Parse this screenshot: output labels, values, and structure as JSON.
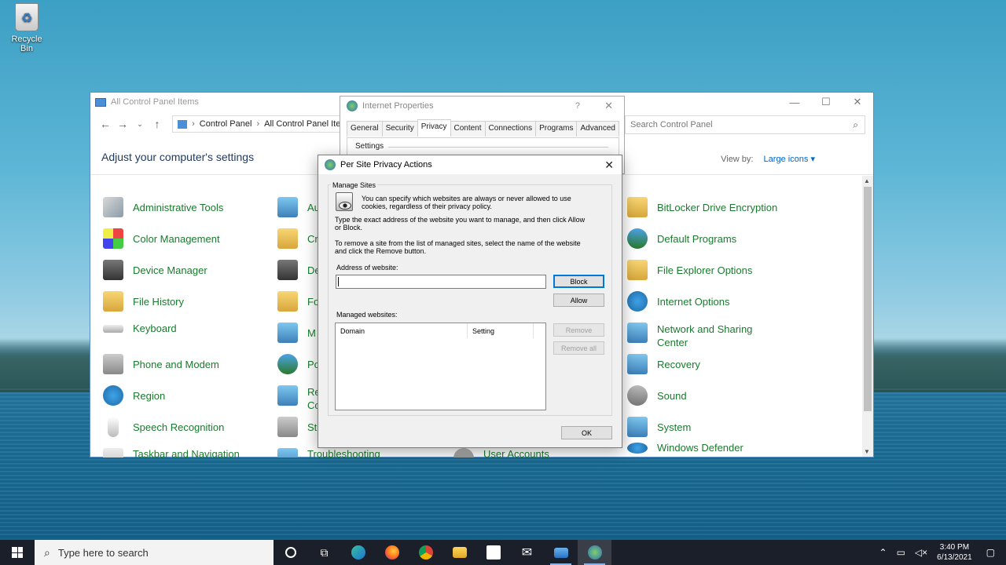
{
  "desktop": {
    "recycle_bin": "Recycle Bin"
  },
  "control_panel": {
    "title": "All Control Panel Items",
    "breadcrumb": [
      "Control Panel",
      "All Control Panel Items"
    ],
    "search_placeholder": "Search Control Panel",
    "heading": "Adjust your computer's settings",
    "view_by_label": "View by:",
    "view_by_value": "Large icons",
    "col1": [
      "Administrative Tools",
      "Color Management",
      "Device Manager",
      "File History",
      "Keyboard",
      "Phone and Modem",
      "Region",
      "Speech Recognition",
      "Taskbar and Navigation"
    ],
    "col2": [
      "Au",
      "Cr",
      "De",
      "Fo",
      "M",
      "Po",
      "Re",
      "Co",
      "St",
      "Troubleshooting"
    ],
    "col3": [
      "User Accounts"
    ],
    "col4": [
      "BitLocker Drive Encryption",
      "Default Programs",
      "File Explorer Options",
      "Internet Options",
      "Network and Sharing",
      "Center",
      "Recovery",
      "Sound",
      "System",
      "Windows Defender"
    ]
  },
  "internet_properties": {
    "title": "Internet Properties",
    "help": "?",
    "tabs": [
      "General",
      "Security",
      "Privacy",
      "Content",
      "Connections",
      "Programs",
      "Advanced"
    ],
    "active_tab": "Privacy",
    "settings_label": "Settings"
  },
  "per_site": {
    "title": "Per Site Privacy Actions",
    "group_label": "Manage Sites",
    "intro_line1": "You can specify which websites are always or never allowed to use",
    "intro_line2": "cookies, regardless of their privacy policy.",
    "type_line1": "Type the exact address of the website you want to manage, and then click Allow",
    "type_line2": "or Block.",
    "remove_line1": "To remove a site from the list of managed sites, select the name of the website",
    "remove_line2": "and click the Remove button.",
    "address_label": "Address of website:",
    "address_value": "",
    "block_label": "Block",
    "allow_label": "Allow",
    "managed_label": "Managed websites:",
    "col_domain": "Domain",
    "col_setting": "Setting",
    "remove_label": "Remove",
    "remove_all_label": "Remove all",
    "ok_label": "OK"
  },
  "taskbar": {
    "search_placeholder": "Type here to search",
    "time": "3:40 PM",
    "date": "6/13/2021"
  }
}
